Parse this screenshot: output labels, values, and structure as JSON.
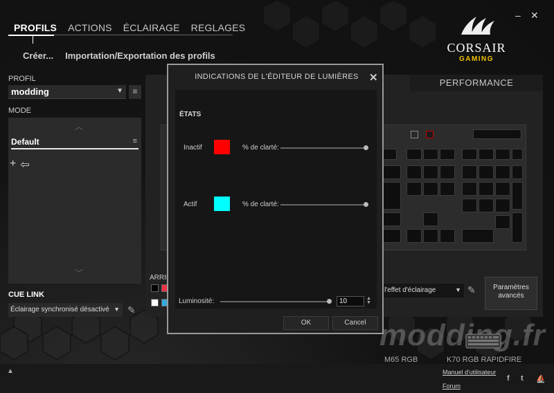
{
  "nav": {
    "tabs": [
      {
        "label": "PROFILS"
      },
      {
        "label": "ACTIONS"
      },
      {
        "label": "ÉCLAIRAGE"
      },
      {
        "label": "REGLAGES"
      }
    ],
    "active_tab": "PROFILS"
  },
  "subnav": {
    "create": "Créer...",
    "import_export": "Importation/Exportation des profils"
  },
  "window_controls": {
    "minimize": "–",
    "close": "✕"
  },
  "logo": {
    "word": "CORSAIR",
    "sub": "GAMING"
  },
  "left_panel": {
    "profile_label": "PROFIL",
    "profile_value": "modding",
    "mode_label": "MODE",
    "mode_item": "Default",
    "cue_link_label": "CUE LINK",
    "cue_link_value": "Éclairage synchronisé désactivé"
  },
  "right_panel": {
    "performance_tab": "PERFORMANCE",
    "arrie_label": "ARRIE",
    "effect_select": "r l'effet d'éclairage",
    "advanced_button": "Paramètres avancés"
  },
  "modal": {
    "title": "INDICATIONS DE L'ÉDITEUR DE LUMIÈRES",
    "states_label": "ÉTATS",
    "inactive_label": "Inactif",
    "inactive_color": "#ff0000",
    "active_label": "Actif",
    "active_color": "#00ffff",
    "clarity_label": "% de clarté:",
    "inactive_clarity": 1.0,
    "active_clarity": 1.0,
    "luminosity_label": "Luminosité:",
    "luminosity_value": "10",
    "luminosity_fraction": 1.0,
    "ok_button": "OK",
    "cancel_button": "Cancel"
  },
  "devices": {
    "device1": "M65 RGB",
    "device2": "K70 RGB RAPIDFIRE"
  },
  "footer": {
    "manual_link": "Manuel d'utilisateur",
    "forum_link": "Forum",
    "expand_icon": "▲"
  },
  "watermark": "modding.fr",
  "colors": {
    "accent_red": "#ff0000",
    "accent_cyan": "#00ffff",
    "logo_gold": "#f0c000"
  }
}
